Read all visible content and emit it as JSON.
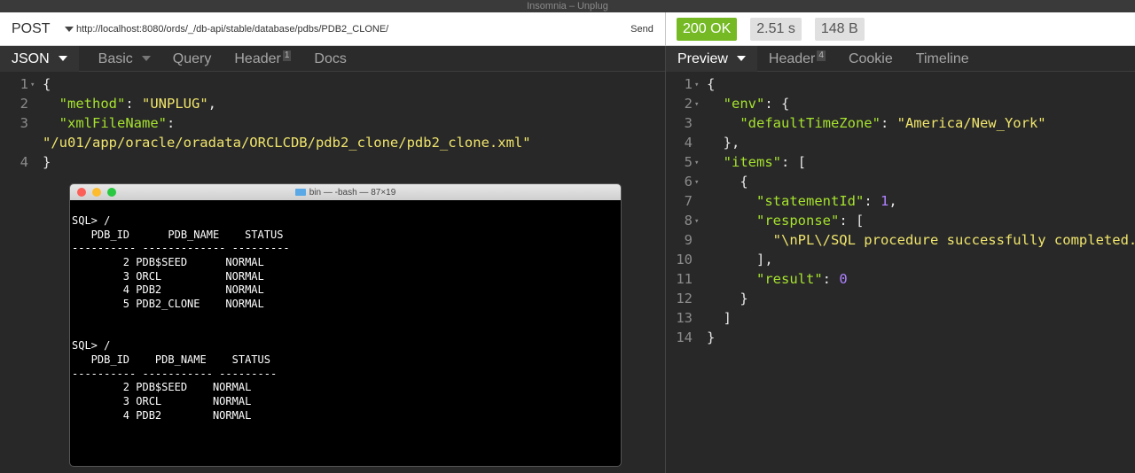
{
  "window": {
    "title": "Insomnia – Unplug"
  },
  "request": {
    "method": "POST",
    "url": "http://localhost:8080/ords/_/db-api/stable/database/pdbs/PDB2_CLONE/",
    "send_label": "Send",
    "tabs": [
      {
        "label": "JSON",
        "active": true
      },
      {
        "label": "Basic"
      },
      {
        "label": "Query"
      },
      {
        "label": "Header",
        "count": "1"
      },
      {
        "label": "Docs"
      }
    ],
    "body_lines": [
      {
        "n": "1",
        "fold": true,
        "text": "{"
      },
      {
        "n": "2",
        "key": "\"method\"",
        "value": "\"UNPLUG\"",
        "tail": ","
      },
      {
        "n": "3",
        "key": "\"xmlFileName\"",
        "tail": ":"
      },
      {
        "n": "",
        "value": "\"/u01/app/oracle/oradata/ORCLCDB/pdb2_clone/pdb2_clone.xml\""
      },
      {
        "n": "4",
        "text": "}"
      }
    ]
  },
  "response": {
    "status": "200 OK",
    "time": "2.51 s",
    "size": "148 B",
    "tabs": [
      {
        "label": "Preview",
        "active": true
      },
      {
        "label": "Header",
        "count": "4"
      },
      {
        "label": "Cookie"
      },
      {
        "label": "Timeline"
      }
    ],
    "lines": [
      {
        "n": "1",
        "fold": true,
        "indent": "",
        "text": "{"
      },
      {
        "n": "2",
        "fold": true,
        "indent": "  ",
        "key": "\"env\"",
        "tail": ": {"
      },
      {
        "n": "3",
        "indent": "    ",
        "key": "\"defaultTimeZone\"",
        "sep": ": ",
        "value": "\"America/New_York\""
      },
      {
        "n": "4",
        "indent": "  ",
        "text": "},"
      },
      {
        "n": "5",
        "fold": true,
        "indent": "  ",
        "key": "\"items\"",
        "tail": ": ["
      },
      {
        "n": "6",
        "fold": true,
        "indent": "    ",
        "text": "{"
      },
      {
        "n": "7",
        "indent": "      ",
        "key": "\"statementId\"",
        "sep": ": ",
        "num": "1",
        "tail": ","
      },
      {
        "n": "8",
        "fold": true,
        "indent": "      ",
        "key": "\"response\"",
        "tail": ": ["
      },
      {
        "n": "9",
        "indent": "        ",
        "value": "\"\\nPL\\/SQL procedure successfully completed.\\n\\n\""
      },
      {
        "n": "10",
        "indent": "      ",
        "text": "],"
      },
      {
        "n": "11",
        "indent": "      ",
        "key": "\"result\"",
        "sep": ": ",
        "num": "0"
      },
      {
        "n": "12",
        "indent": "    ",
        "text": "}"
      },
      {
        "n": "13",
        "indent": "  ",
        "text": "]"
      },
      {
        "n": "14",
        "indent": "",
        "text": "}"
      }
    ]
  },
  "terminal": {
    "title": "bin — -bash — 87×19",
    "lines": [
      "SQL> /",
      "   PDB_ID      PDB_NAME    STATUS",
      "---------- ------------- ---------",
      "        2 PDB$SEED      NORMAL",
      "        3 ORCL          NORMAL",
      "        4 PDB2          NORMAL",
      "        5 PDB2_CLONE    NORMAL",
      "",
      "",
      "SQL> /",
      "   PDB_ID    PDB_NAME    STATUS",
      "---------- ----------- ---------",
      "        2 PDB$SEED    NORMAL",
      "        3 ORCL        NORMAL",
      "        4 PDB2        NORMAL"
    ]
  },
  "colors": {
    "status_ok": "#75ba24",
    "key": "#a6e22e",
    "string": "#f0e56c",
    "number": "#ae81ff"
  }
}
